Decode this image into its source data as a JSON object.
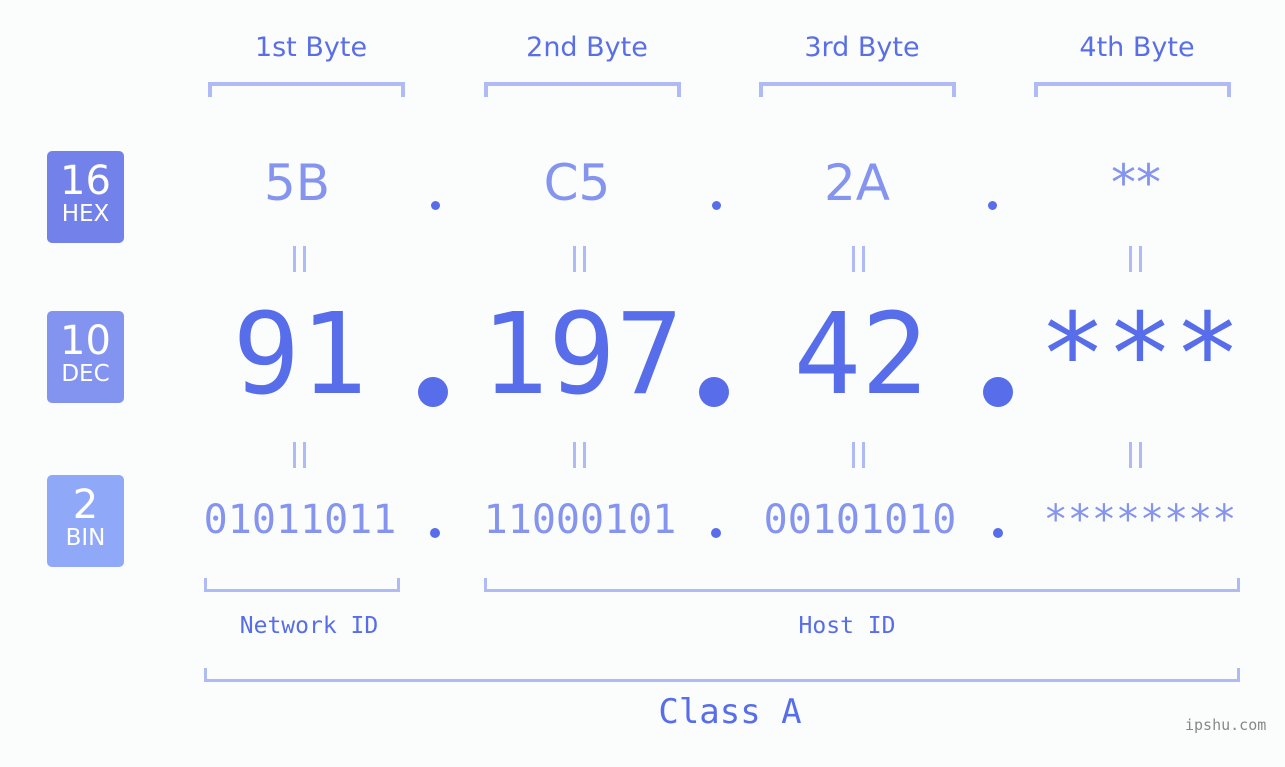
{
  "badges": [
    {
      "num": "16",
      "label": "HEX",
      "color": "#7382ea"
    },
    {
      "num": "10",
      "label": "DEC",
      "color": "#8393f0"
    },
    {
      "num": "2",
      "label": "BIN",
      "color": "#8fa8f8"
    }
  ],
  "bytes": [
    {
      "title": "1st Byte",
      "hex": "5B",
      "dec": "91",
      "bin": "01011011"
    },
    {
      "title": "2nd Byte",
      "hex": "C5",
      "dec": "197",
      "bin": "11000101"
    },
    {
      "title": "3rd Byte",
      "hex": "2A",
      "dec": "42",
      "bin": "00101010"
    },
    {
      "title": "4th Byte",
      "hex": "**",
      "dec": "***",
      "bin": "********"
    }
  ],
  "equals_sign": "=",
  "separator": ".",
  "network_id_label": "Network ID",
  "host_id_label": "Host ID",
  "class_label": "Class A",
  "watermark": "ipshu.com",
  "colors": {
    "accent": "#576de9",
    "light": "#8594ee",
    "bracket": "#b0bbf5"
  }
}
